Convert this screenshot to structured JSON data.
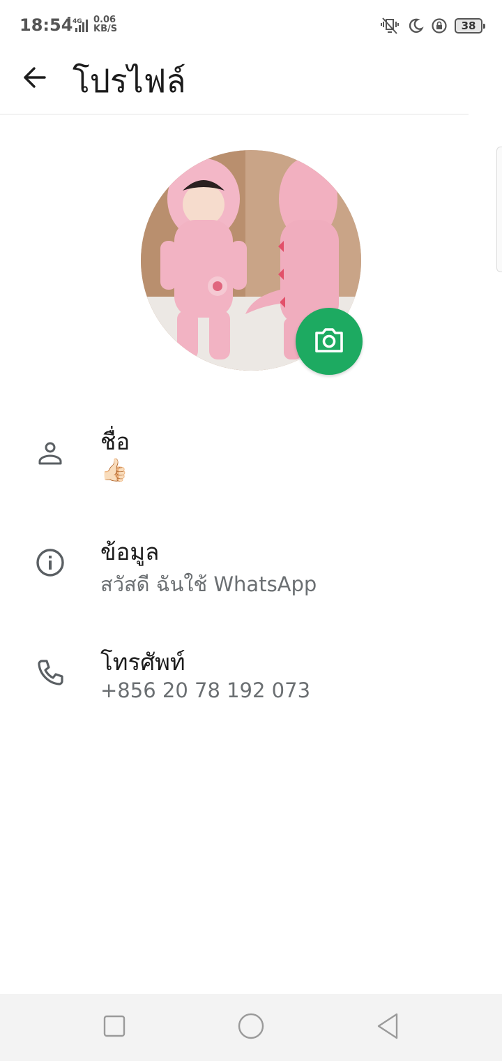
{
  "status_bar": {
    "time": "18:54",
    "network_type": "4G",
    "speed_value": "0.06",
    "speed_unit": "KB/S",
    "battery_level": "38"
  },
  "app_bar": {
    "title": "โปรไฟล์",
    "back_icon": "arrow-left-icon"
  },
  "profile": {
    "photo_icon": "profile-photo",
    "camera_icon": "camera-icon",
    "accent_color": "#1daa61"
  },
  "rows": {
    "name": {
      "label": "ชื่อ",
      "value": "👍🏻",
      "icon": "person-icon"
    },
    "about": {
      "label": "ข้อมูล",
      "value": "สวัสดี ฉันใช้ WhatsApp",
      "icon": "info-icon"
    },
    "phone": {
      "label": "โทรศัพท์",
      "value": "+856 20 78 192 073",
      "icon": "phone-icon"
    }
  },
  "nav_bar": {
    "recent_icon": "square-icon",
    "home_icon": "circle-icon",
    "back_icon": "triangle-back-icon"
  }
}
